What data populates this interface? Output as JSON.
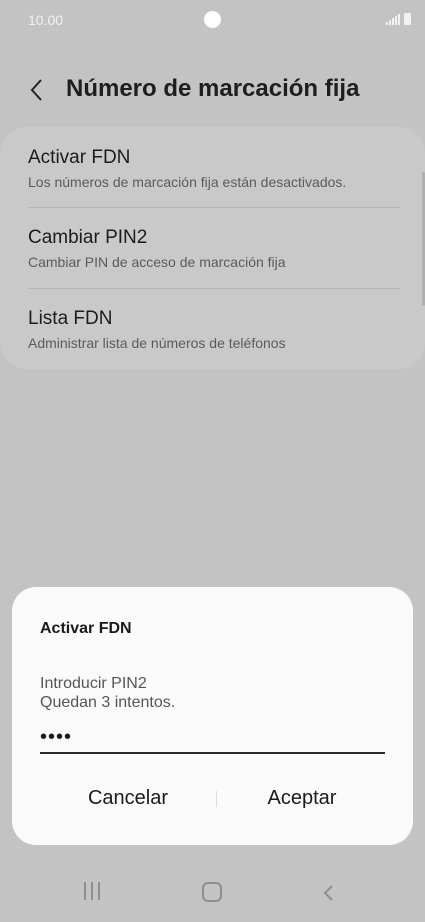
{
  "status_bar": {
    "time": "10.00",
    "icons": [
      "signal-icon",
      "battery-icon"
    ]
  },
  "header": {
    "title": "Número de marcación fija",
    "back_icon": "chevron-left-icon"
  },
  "settings_items": [
    {
      "title": "Activar FDN",
      "subtitle": "Los números de marcación fija están desactivados."
    },
    {
      "title": "Cambiar PIN2",
      "subtitle": "Cambiar PIN de acceso de marcación fija"
    },
    {
      "title": "Lista FDN",
      "subtitle": "Administrar lista de números de teléfonos"
    }
  ],
  "dialog": {
    "title": "Activar FDN",
    "message_line1": "Introducir PIN2",
    "message_line2": "Quedan 3 intentos.",
    "input_value": "••••",
    "cancel_label": "Cancelar",
    "accept_label": "Aceptar"
  },
  "nav_bar": {
    "icons": [
      "recent-apps-icon",
      "home-icon",
      "back-icon"
    ]
  },
  "colors": {
    "background": "#c3c3c3",
    "card": "#c9c9c9",
    "dialog": "#fafafa",
    "text": "#1f1f1f",
    "subtext": "#5b5b5b"
  }
}
